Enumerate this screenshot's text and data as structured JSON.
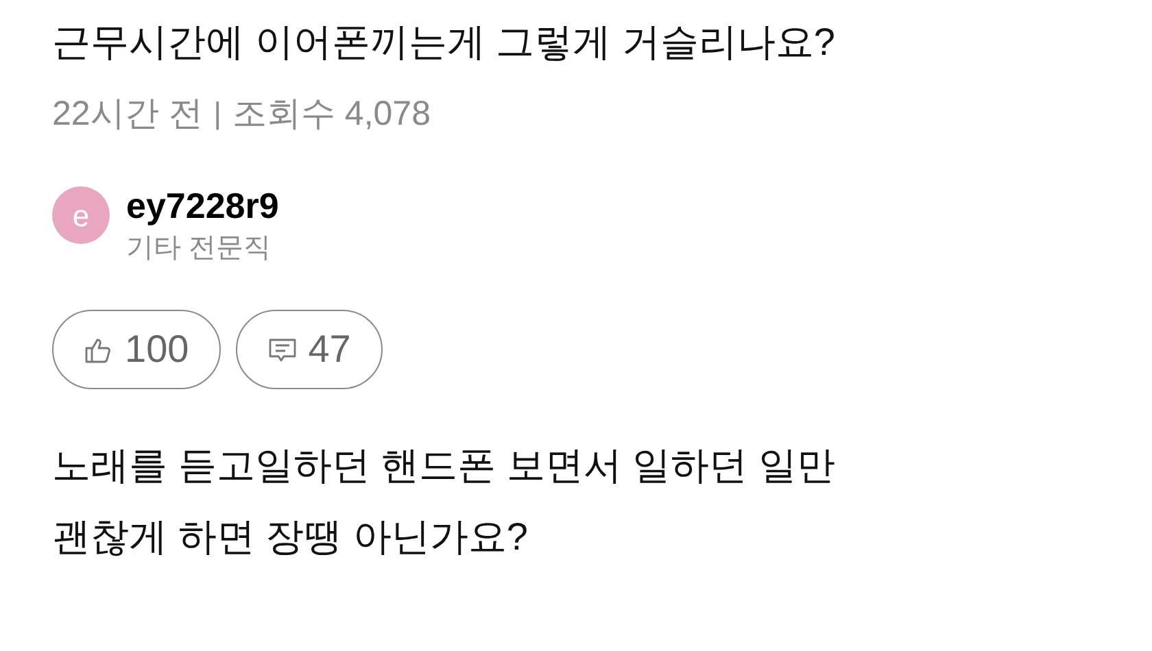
{
  "post": {
    "title": "근무시간에 이어폰끼는게 그렇게 거슬리나요?",
    "time": "22시간 전",
    "separator": "|",
    "views": "조회수 4,078",
    "author": {
      "avatar_letter": "e",
      "name": "ey7228r9",
      "job": "기타 전문직"
    },
    "actions": [
      {
        "kind": "like",
        "count": "100"
      },
      {
        "kind": "comment",
        "count": "47"
      }
    ],
    "body": [
      "노래를 듣고일하던 핸드폰 보면서 일하던 일만",
      "괜찮게 하면 장땡 아닌가요?"
    ]
  }
}
